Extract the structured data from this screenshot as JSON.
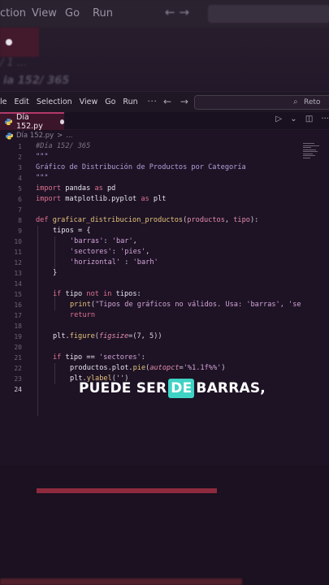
{
  "background": {
    "menu": [
      "ction",
      "View",
      "Go",
      "Run"
    ],
    "line1": "/ 1 ...",
    "line2": "ia 152/ 365"
  },
  "menubar": {
    "items": [
      "le",
      "Edit",
      "Selection",
      "View",
      "Go",
      "Run"
    ],
    "more": "···",
    "back": "←",
    "forward": "→",
    "search_text": "Reto"
  },
  "tab": {
    "filename": "Día 152.py"
  },
  "tab_actions": {
    "run": "▷",
    "run_menu": "⌄",
    "split": "◫",
    "more": "···"
  },
  "breadcrumb": {
    "file": "Día 152.py",
    "sep": ">",
    "more": "..."
  },
  "code": {
    "line_numbers": [
      "1",
      "2",
      "3",
      "4",
      "5",
      "6",
      "7",
      "8",
      "9",
      "10",
      "11",
      "12",
      "13",
      "14",
      "15",
      "16",
      "17",
      "18",
      "19",
      "20",
      "21",
      "22",
      "23",
      "24"
    ],
    "l1": "#Día 152/ 365",
    "l2": "\"\"\"",
    "l3": "Gráfico de Distribución de Productos por Categoría",
    "l4": "\"\"\"",
    "l5_kw": "import",
    "l5_mod": " pandas ",
    "l5_as": "as",
    "l5_alias": " pd",
    "l6_kw": "import",
    "l6_mod": " matplotlib.pyplot ",
    "l6_as": "as",
    "l6_alias": " plt",
    "l8_def": "def",
    "l8_fn": "graficar_distribucion_productos",
    "l8_open": "(",
    "l8_p1": "productos",
    "l8_comma": ", ",
    "l8_p2": "tipo",
    "l8_close": "):",
    "l9": "tipos = {",
    "l10_key": "'barras'",
    "l10_colon": ": ",
    "l10_val": "'bar'",
    "l10_end": ",",
    "l11_key": "'sectores'",
    "l11_colon": ": ",
    "l11_val": "'pies'",
    "l11_end": ",",
    "l12_key": "'horizontal'",
    "l12_colon": " : ",
    "l12_val": "'barh'",
    "l13": "}",
    "l15_if": "if",
    "l15_rest1": " tipo ",
    "l15_not": "not in",
    "l15_rest2": " tipos:",
    "l16_fn": "print",
    "l16_open": "(",
    "l16_str": "\"Tipos de gráficos no válidos. Usa: 'barras', 'se",
    "l17": "return",
    "l19_obj": "plt.",
    "l19_fn": "figure",
    "l19_open": "(",
    "l19_kw": "figsize",
    "l19_rest": "=(7, 5))",
    "l21_if": "if",
    "l21_rest": " tipo == ",
    "l21_str": "'sectores'",
    "l21_end": ":",
    "l22_obj": "productos.plot.",
    "l22_fn": "pie",
    "l22_open": "(",
    "l22_kw": "autopct",
    "l22_eq": "=",
    "l22_str": "'%1.1f%%'",
    "l22_end": ")",
    "l23_obj": "plt.",
    "l23_fn": "ylabel",
    "l23_rest": "('')"
  },
  "caption": {
    "before": "PUEDE SER",
    "highlight": "DE",
    "after": "BARRAS,"
  },
  "colors": {
    "tab_accent": "#b23a6b",
    "caption_highlight": "#3ed3c4",
    "bottom_bar": "#8e2a3e"
  }
}
